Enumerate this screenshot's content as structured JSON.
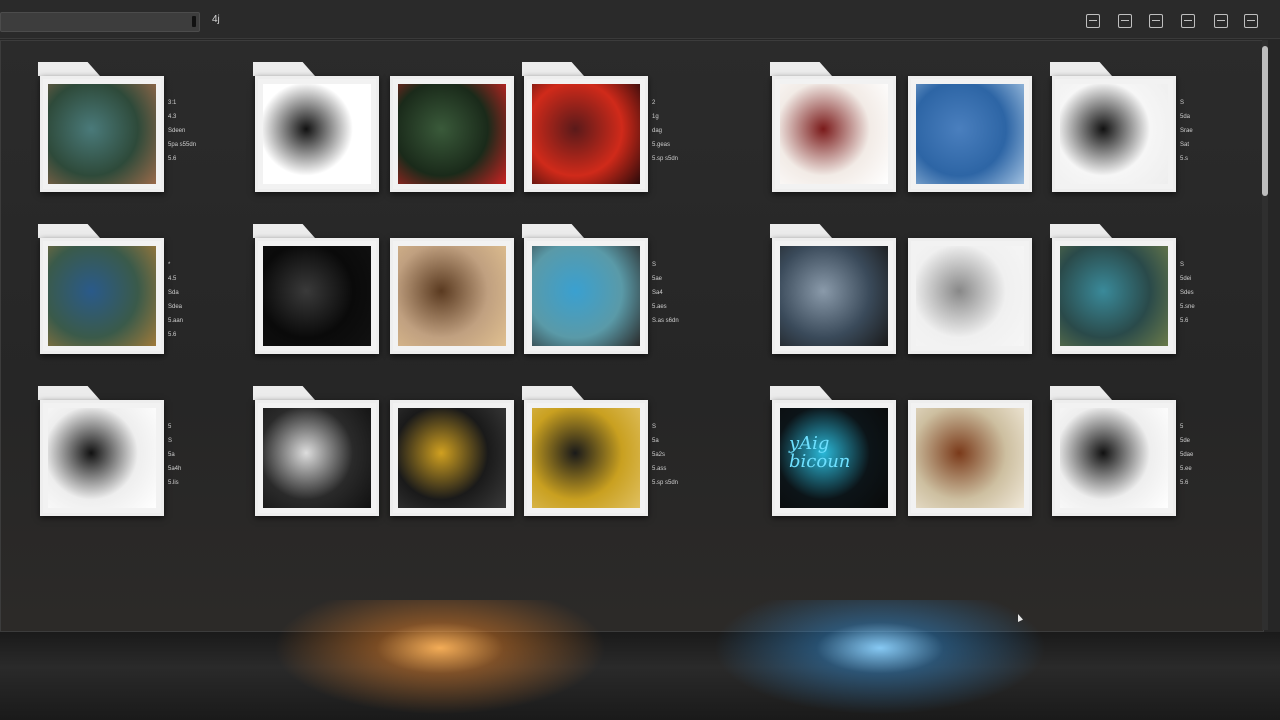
{
  "toolbar": {
    "path_text": "4j",
    "tools": [
      "view-icon",
      "grid-icon",
      "list-icon",
      "gallery-icon",
      "info-icon",
      "close-icon"
    ]
  },
  "items": [
    {
      "id": "f1",
      "meta": [
        "3:1",
        "4.3",
        "Sdeen",
        "5pa  s55dn",
        "5.6"
      ],
      "colors": [
        "#2e4a3a",
        "#4a7a7a",
        "#9a6a4a"
      ]
    },
    {
      "id": "f2",
      "meta": [],
      "colors": [
        "#ffffff",
        "#111111",
        "#ffffff"
      ]
    },
    {
      "id": "f3",
      "meta": [],
      "colors": [
        "#1a2a1a",
        "#3a5a3a",
        "#cc2222"
      ]
    },
    {
      "id": "f4",
      "meta": [
        "2",
        "1g",
        "dag",
        "5.geas",
        "5.sp  s5dn"
      ],
      "colors": [
        "#d02a1a",
        "#5a1a1a",
        "#2a0a0a"
      ]
    },
    {
      "id": "f5",
      "meta": [],
      "colors": [
        "#f2ebe6",
        "#7a1a1a",
        "#ffffff"
      ]
    },
    {
      "id": "f6",
      "meta": [],
      "colors": [
        "#2d65a5",
        "#4a7fbe",
        "#a0c0e0"
      ]
    },
    {
      "id": "f7",
      "meta": [
        "S",
        "5da",
        "Srae",
        "Sat",
        "5.s"
      ],
      "colors": [
        "#f6f6f6",
        "#111111",
        "#eeeeee"
      ]
    },
    {
      "id": "f8",
      "meta": [
        "*",
        "4.5",
        "Sda",
        "Sdea",
        "5.aan",
        "5.6"
      ],
      "colors": [
        "#3a5a4a",
        "#2a5a8a",
        "#a07a3a"
      ]
    },
    {
      "id": "f9",
      "meta": [],
      "colors": [
        "#0a0a0a",
        "#3a3a3a",
        "#111111"
      ]
    },
    {
      "id": "f10",
      "meta": [],
      "colors": [
        "#c0a080",
        "#5a3a20",
        "#e0c090"
      ]
    },
    {
      "id": "f11",
      "meta": [
        "S",
        "5ae",
        "Sa4",
        "5.aes",
        "S.as  s6dn"
      ],
      "colors": [
        "#5a9aa8",
        "#3aa0d0",
        "#2a2a2a"
      ]
    },
    {
      "id": "f12",
      "meta": [],
      "colors": [
        "#3a4a5a",
        "#8a9aaa",
        "#1a1a1a"
      ]
    },
    {
      "id": "f13",
      "meta": [],
      "colors": [
        "#f0f0f0",
        "#888888",
        "#f6f6f6"
      ]
    },
    {
      "id": "f14",
      "meta": [
        "S",
        "5dei",
        "Sdes",
        "5.sne",
        "5.6"
      ],
      "colors": [
        "#2a4a4a",
        "#3a8a9a",
        "#6a7a4a"
      ]
    },
    {
      "id": "f15",
      "meta": [
        "5",
        "S",
        "5a",
        "5a4h",
        "5.lis"
      ],
      "colors": [
        "#eeeeee",
        "#111111",
        "#ffffff"
      ]
    },
    {
      "id": "f16",
      "meta": [],
      "colors": [
        "#2a2a2a",
        "#dddddd",
        "#111111"
      ]
    },
    {
      "id": "f17",
      "meta": [],
      "colors": [
        "#1a1a1a",
        "#d0a020",
        "#3a3a3a"
      ]
    },
    {
      "id": "f18",
      "meta": [
        "S",
        "5a",
        "5a2s",
        "5.ass",
        "5.sp  s5dn"
      ],
      "colors": [
        "#c9a020",
        "#1a1a1a",
        "#e0c060"
      ]
    },
    {
      "id": "f19",
      "meta": [],
      "colors": [
        "#0c1418",
        "#2ab8d8",
        "#0a0a0a"
      ]
    },
    {
      "id": "f20",
      "meta": [],
      "colors": [
        "#cdbfa0",
        "#7a3a1a",
        "#f0e8d8"
      ]
    },
    {
      "id": "f21",
      "meta": [
        "5",
        "5de",
        "5dae",
        "5.ee",
        "5.6"
      ],
      "colors": [
        "#eeeeee",
        "#111111",
        "#ffffff"
      ]
    }
  ],
  "caption_art": {
    "line1": "yAig",
    "line2": "bicoun"
  }
}
